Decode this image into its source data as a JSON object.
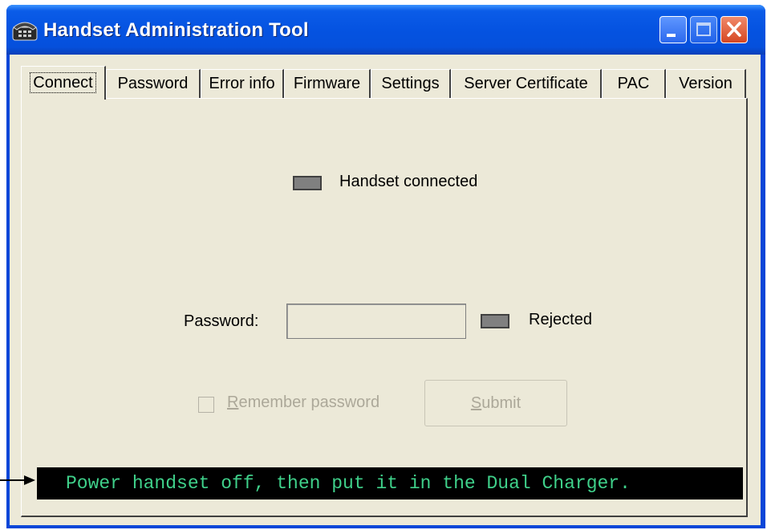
{
  "window": {
    "title": "Handset Administration Tool",
    "icon": "phone-icon"
  },
  "tabs": [
    {
      "label": "Connect",
      "active": true
    },
    {
      "label": "Password"
    },
    {
      "label": "Error info"
    },
    {
      "label": "Firmware"
    },
    {
      "label": "Settings"
    },
    {
      "label": "Server Certificate"
    },
    {
      "label": "PAC"
    },
    {
      "label": "Version"
    }
  ],
  "connect": {
    "handset_connected_label": "Handset connected",
    "password_label": "Password:",
    "password_value": "",
    "rejected_label": "Rejected",
    "remember_prefix": "R",
    "remember_rest": "emember password",
    "remember_checked": false,
    "submit_prefix": "S",
    "submit_rest": "ubmit"
  },
  "status": {
    "message": "Power handset off, then put it in the Dual Charger."
  },
  "colors": {
    "titlebar": "#0553e1",
    "client_bg": "#ece9d8",
    "indicator": "#808080",
    "status_bg": "#000000",
    "status_text": "#3fd08a"
  }
}
